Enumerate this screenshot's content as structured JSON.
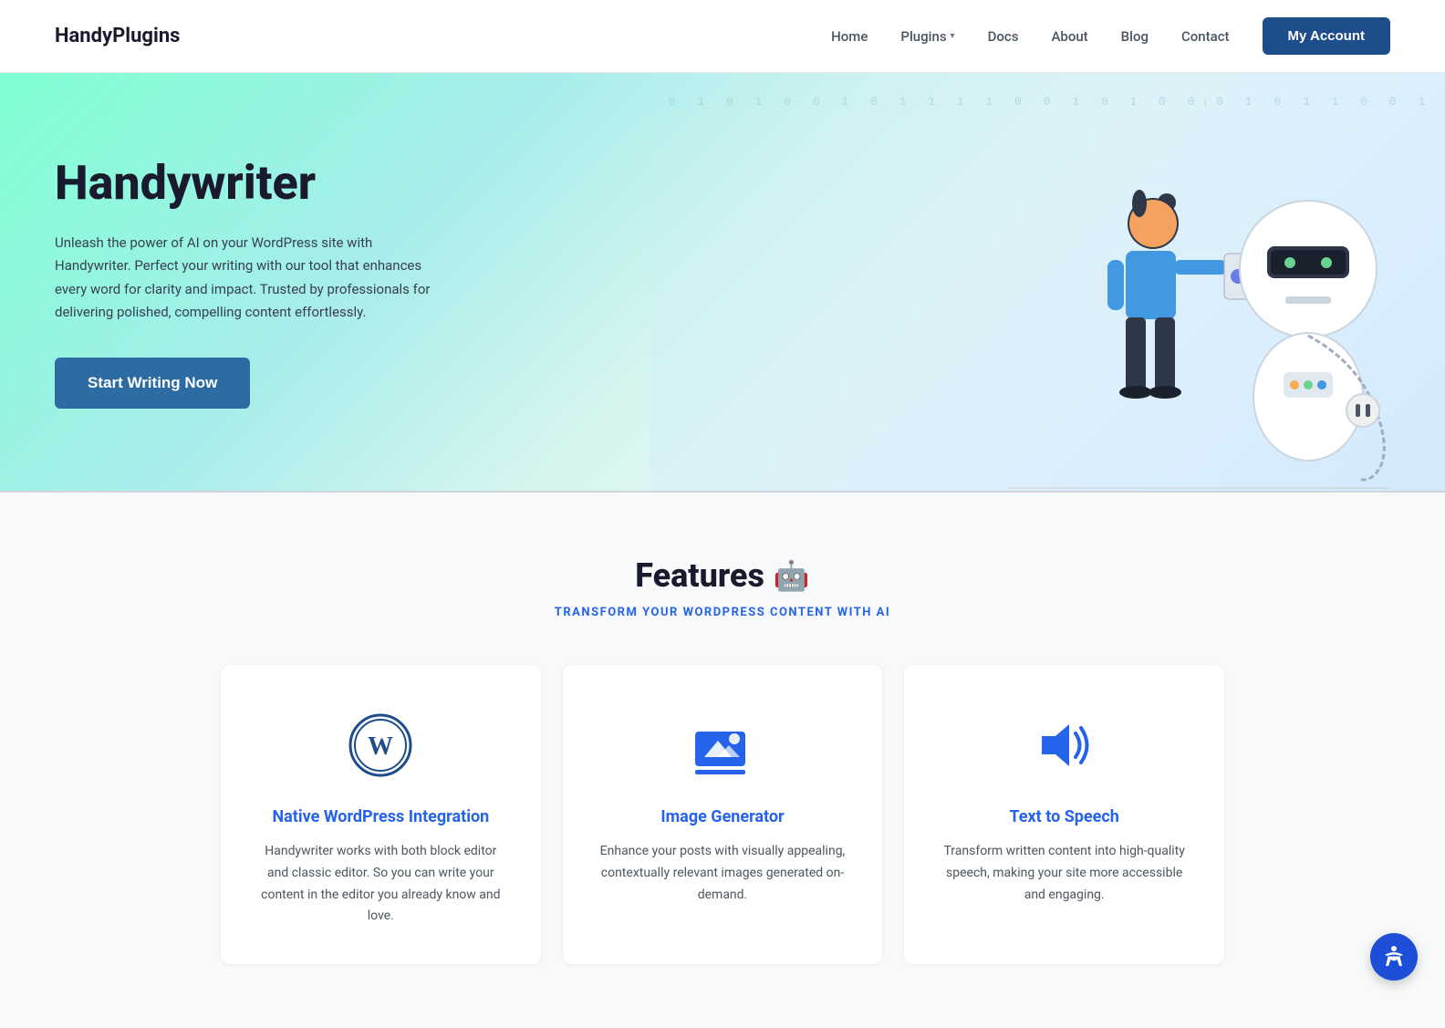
{
  "brand": {
    "name": "HandyPlugins"
  },
  "nav": {
    "items": [
      {
        "label": "Home",
        "hasDropdown": false
      },
      {
        "label": "Plugins",
        "hasDropdown": true
      },
      {
        "label": "Docs",
        "hasDropdown": false
      },
      {
        "label": "About",
        "hasDropdown": false
      },
      {
        "label": "Blog",
        "hasDropdown": false
      },
      {
        "label": "Contact",
        "hasDropdown": false
      }
    ],
    "account_button": "My Account"
  },
  "hero": {
    "title": "Handywriter",
    "description": "Unleash the power of AI on your WordPress site with Handywriter. Perfect your writing with our tool that enhances every word for clarity and impact. Trusted by professionals for delivering polished, compelling content effortlessly.",
    "cta_label": "Start Writing Now"
  },
  "features": {
    "title": "Features",
    "subtitle": "TRANSFORM YOUR WORDPRESS CONTENT WITH AI",
    "robot_emoji": "🤖",
    "cards": [
      {
        "icon": "wordpress",
        "title": "Native WordPress Integration",
        "description": "Handywriter works with both block editor and classic editor. So you can write your content in the editor you already know and love."
      },
      {
        "icon": "image-generator",
        "title": "Image Generator",
        "description": "Enhance your posts with visually appealing, contextually relevant images generated on-demand."
      },
      {
        "icon": "text-to-speech",
        "title": "Text to Speech",
        "description": "Transform written content into high-quality speech, making your site more accessible and engaging."
      }
    ]
  },
  "accessibility": {
    "button_label": "Accessibility"
  }
}
